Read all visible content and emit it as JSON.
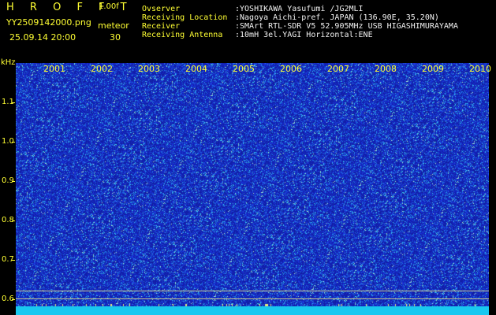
{
  "header": {
    "app_title": "H R O F F T",
    "version": "1.00f",
    "filename": "YY2509142000.png",
    "timestamp": "25.09.14 20:00",
    "meteor_label": "meteor",
    "meteor_count": "30"
  },
  "info": [
    {
      "label": "Ovserver",
      "value": ":YOSHIKAWA Yasufumi /JG2MLI"
    },
    {
      "label": "Receiving Location",
      "value": ":Nagoya Aichi-pref. JAPAN (136.90E, 35.20N)"
    },
    {
      "label": "Receiver",
      "value": ":SMArt RTL-SDR V5 52.905MHz USB HIGASHIMURAYAMA"
    },
    {
      "label": "Receiving Antenna",
      "value": ":10mH 3el.YAGI Horizontal:ENE"
    }
  ],
  "y_axis": {
    "unit": "kHz",
    "ticks": [
      "1.1",
      "1.0",
      "0.9",
      "0.8",
      "0.7",
      "0.6"
    ]
  },
  "x_axis": {
    "ticks": [
      "2001",
      "2002",
      "2003",
      "2004",
      "2005",
      "2006",
      "2007",
      "2008",
      "2009",
      "2010"
    ]
  },
  "colors": {
    "label": "#ffff33",
    "value": "#f2f2f2",
    "background": "#000000",
    "spectrum_base": "#1428a8",
    "bottom_strip": "#18c8f0"
  }
}
